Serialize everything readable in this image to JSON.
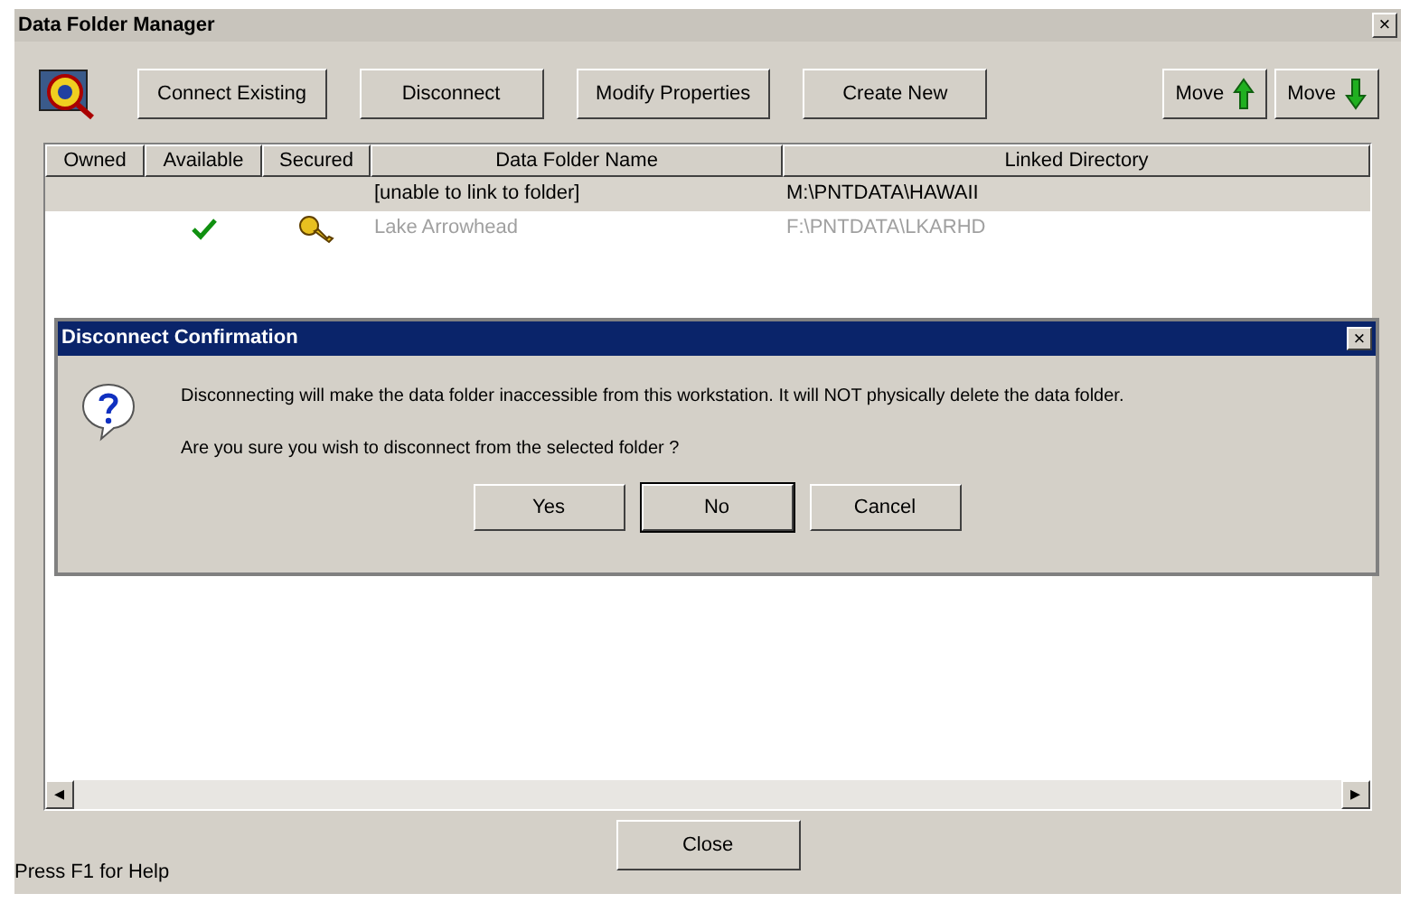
{
  "window": {
    "title": "Data Folder Manager",
    "close": "×"
  },
  "toolbar": {
    "buttons": [
      "Connect Existing",
      "Disconnect",
      "Modify Properties",
      "Create New"
    ],
    "move_buttons": [
      {
        "label": "Move",
        "kind": "up"
      },
      {
        "label": "Move",
        "kind": "down"
      }
    ]
  },
  "table": {
    "columns": [
      "Owned",
      "Available",
      "Secured",
      "Data Folder Name",
      "Linked Directory"
    ],
    "rows": [
      {
        "name": "[unable to link to folder]",
        "directory": "M:\\PNTDATA\\HAWAII",
        "available": false,
        "secured": false,
        "selected": true,
        "disabled": false
      },
      {
        "name": "Lake Arrowhead",
        "directory": "F:\\PNTDATA\\LKARHD",
        "available": true,
        "secured": true,
        "selected": false,
        "disabled": true
      }
    ]
  },
  "dialog": {
    "title": "Disconnect Confirmation",
    "close": "×",
    "message": "Disconnecting will make the data folder inaccessible from this workstation. It will NOT physically delete the data folder.",
    "question": "Are you sure you wish to disconnect from the selected folder ?",
    "buttons": [
      {
        "label": "Yes",
        "selected": false
      },
      {
        "label": "No",
        "selected": true
      },
      {
        "label": "Cancel",
        "selected": false
      }
    ]
  },
  "scrollbar": {
    "left": "◂",
    "right": "▸"
  },
  "close_button": "Close",
  "status_bar": "Press F1 for Help"
}
